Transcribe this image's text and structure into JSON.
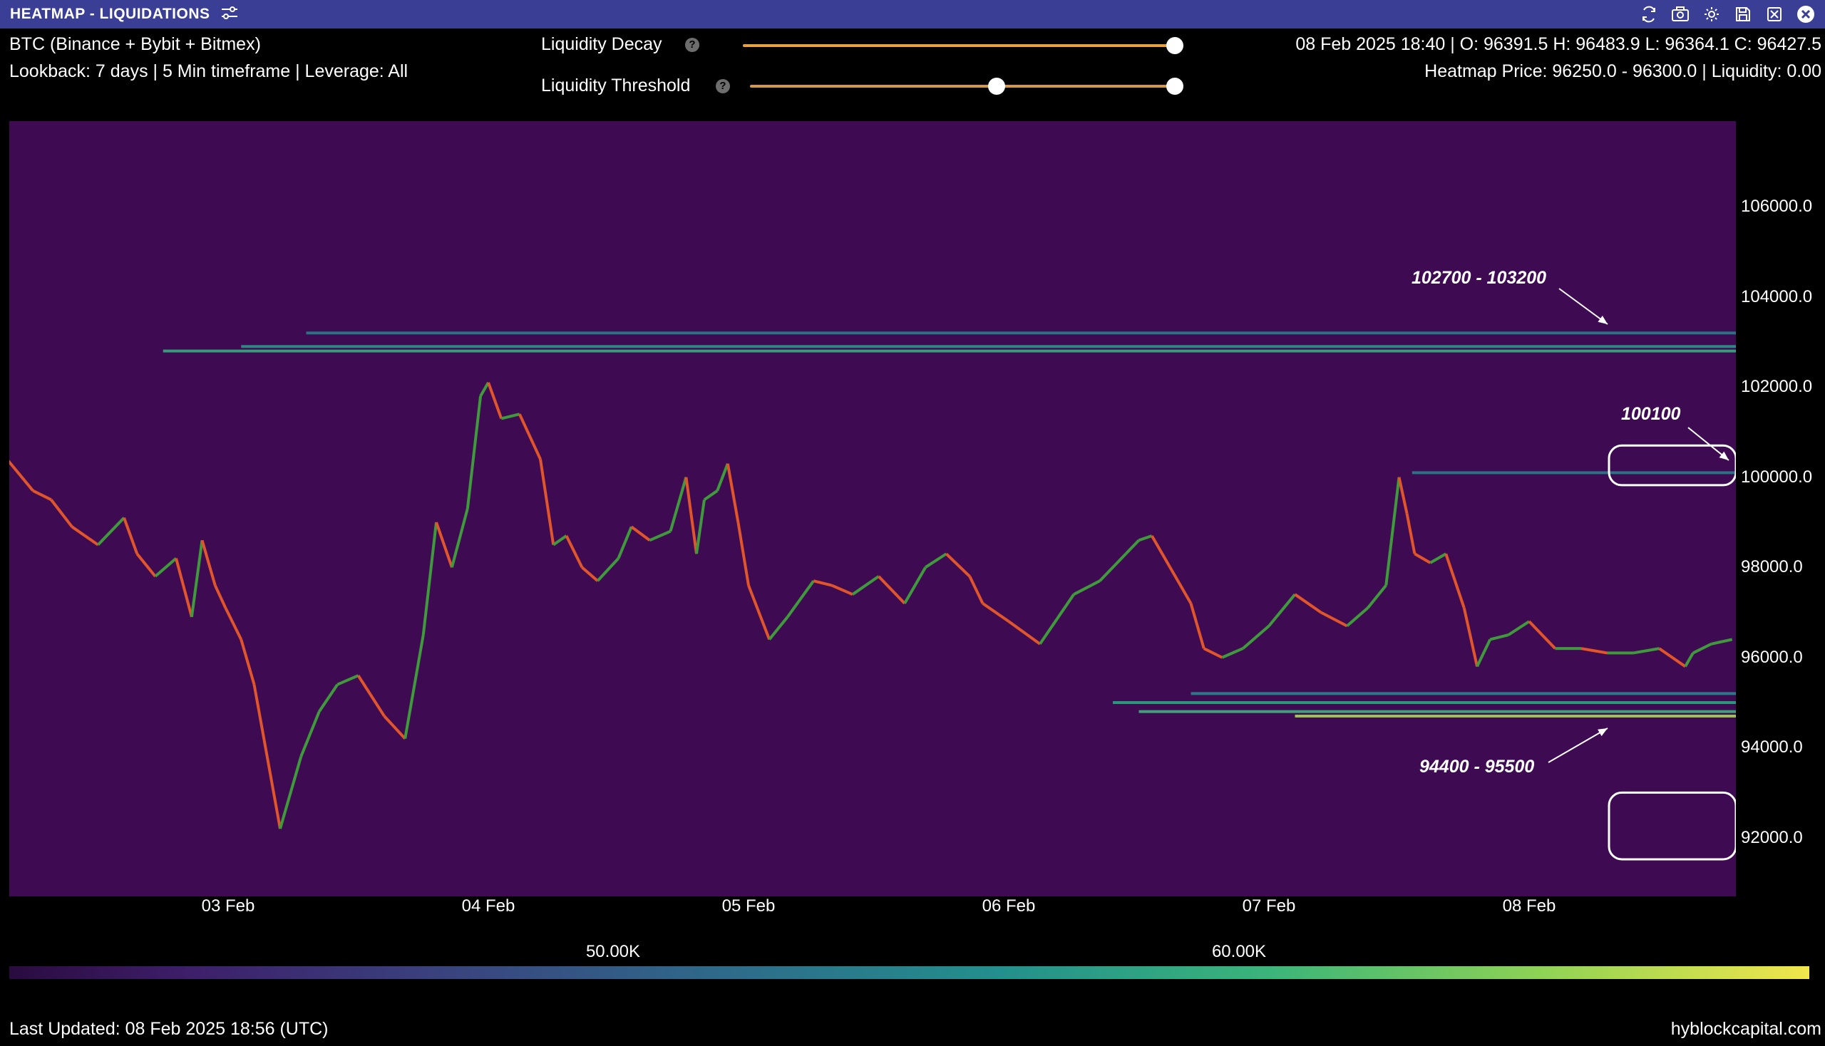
{
  "window": {
    "title": "HEATMAP - LIQUIDATIONS",
    "toolbar_icons": [
      "refresh-icon",
      "camera-icon",
      "gear-icon",
      "save-icon",
      "export-icon",
      "close-icon"
    ]
  },
  "header": {
    "left_line1": "BTC (Binance + Bybit + Bitmex)",
    "left_line2": "Lookback: 7 days | 5 Min timeframe | Leverage: All",
    "right_line1": "08 Feb 2025 18:40 | O: 96391.5 H: 96483.9 L: 96364.1 C: 96427.5",
    "right_line2": "Heatmap Price: 96250.0 - 96300.0 | Liquidity: 0.00"
  },
  "controls": {
    "decay_label": "Liquidity Decay",
    "decay_value": 1.0,
    "threshold_label": "Liquidity Threshold",
    "threshold_range": [
      0.58,
      1.0
    ]
  },
  "chart_data": {
    "type": "heatmap",
    "title": "",
    "y_ticks": [
      "106000.0",
      "104000.0",
      "102000.0",
      "100000.0",
      "98000.0",
      "96000.0",
      "94000.0",
      "92000.0"
    ],
    "y_range": [
      90700,
      107900
    ],
    "x_ticks": [
      "03 Feb",
      "04 Feb",
      "05 Feb",
      "06 Feb",
      "07 Feb",
      "08 Feb"
    ],
    "price_series_x_days": [
      2.0,
      2.08,
      2.15,
      2.25,
      2.32,
      2.4,
      2.5,
      2.6,
      2.65,
      2.72,
      2.8,
      2.86,
      2.9,
      2.95,
      2.99,
      3.05,
      3.1,
      3.2,
      3.28,
      3.35,
      3.42,
      3.5,
      3.6,
      3.68,
      3.75,
      3.8,
      3.86,
      3.92,
      3.97,
      4.0,
      4.05,
      4.12,
      4.2,
      4.25,
      4.3,
      4.36,
      4.42,
      4.5,
      4.55,
      4.62,
      4.7,
      4.76,
      4.8,
      4.83,
      4.88,
      4.92,
      4.96,
      5.0,
      5.08,
      5.15,
      5.25,
      5.32,
      5.4,
      5.5,
      5.6,
      5.68,
      5.76,
      5.85,
      5.9,
      6.0,
      6.12,
      6.25,
      6.35,
      6.45,
      6.5,
      6.55,
      6.62,
      6.7,
      6.75,
      6.82,
      6.9,
      7.0,
      7.1,
      7.2,
      7.3,
      7.38,
      7.45,
      7.5,
      7.53,
      7.56,
      7.62,
      7.68,
      7.75,
      7.8,
      7.85,
      7.92,
      8.0,
      8.1,
      8.2,
      8.3,
      8.4,
      8.5,
      8.6,
      8.63,
      8.7,
      8.78
    ],
    "price_series_y": [
      99300,
      99900,
      100400,
      99700,
      99500,
      98900,
      98500,
      99100,
      98300,
      97800,
      98200,
      96900,
      98600,
      97600,
      97100,
      96400,
      95400,
      92200,
      93800,
      94800,
      95400,
      95600,
      94700,
      94200,
      96500,
      99000,
      98000,
      99300,
      101800,
      102100,
      101300,
      101400,
      100400,
      98500,
      98700,
      98000,
      97700,
      98200,
      98900,
      98600,
      98800,
      100000,
      98300,
      99500,
      99700,
      100300,
      99000,
      97600,
      96400,
      96900,
      97700,
      97600,
      97400,
      97800,
      97200,
      98000,
      98300,
      97800,
      97200,
      96800,
      96300,
      97400,
      97700,
      98300,
      98600,
      98700,
      98000,
      97200,
      96200,
      96000,
      96200,
      96700,
      97400,
      97000,
      96700,
      97100,
      97600,
      100000,
      99200,
      98300,
      98100,
      98300,
      97100,
      95800,
      96400,
      96500,
      96800,
      96200,
      96200,
      96100,
      96100,
      96200,
      95800,
      96100,
      96300,
      96400
    ],
    "liquidity_bands": [
      {
        "price": 102800,
        "from_day": 2.75,
        "intensity": 0.55
      },
      {
        "price": 102900,
        "from_day": 3.05,
        "intensity": 0.45
      },
      {
        "price": 103200,
        "from_day": 3.3,
        "intensity": 0.3
      },
      {
        "price": 100100,
        "from_day": 7.55,
        "intensity": 0.3
      },
      {
        "price": 95200,
        "from_day": 6.7,
        "intensity": 0.35
      },
      {
        "price": 95000,
        "from_day": 6.4,
        "intensity": 0.5
      },
      {
        "price": 94800,
        "from_day": 6.5,
        "intensity": 0.6
      },
      {
        "price": 94700,
        "from_day": 7.1,
        "intensity": 0.85
      }
    ],
    "colorbar_ticks": [
      "50.00K",
      "60.00K"
    ],
    "annotations": [
      {
        "text": "102700 - 103200"
      },
      {
        "text": "100100"
      },
      {
        "text": "94400 - 95500"
      }
    ]
  },
  "footer": {
    "last_updated": "Last Updated: 08 Feb 2025 18:56 (UTC)",
    "source": "hyblockcapital.com"
  }
}
